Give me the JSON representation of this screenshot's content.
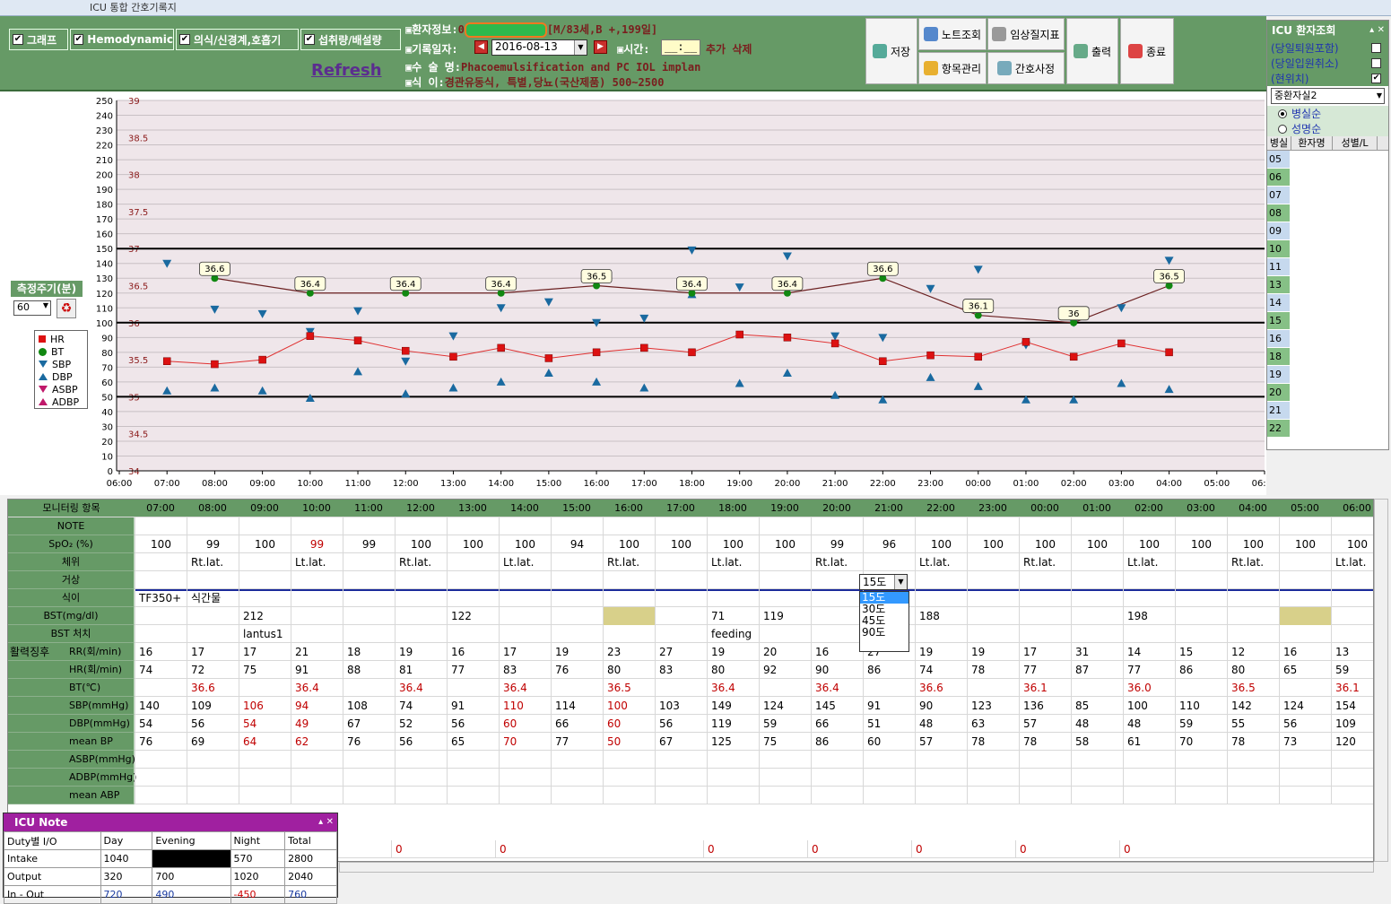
{
  "window": {
    "title": "ICU 통합 간호기록지"
  },
  "checkboxes": [
    {
      "label": "그래프",
      "checked": "✔"
    },
    {
      "label": "Hemodynamic",
      "checked": "✔"
    },
    {
      "label": "의식/신경계,호흡기",
      "checked": "✔"
    },
    {
      "label": "섭취량/배설량",
      "checked": "✔"
    }
  ],
  "refresh_label": "Refresh",
  "patient": {
    "info_label": "▣환자정보:",
    "info_prefix": "0",
    "info_value": "[M/83세,B +,199일]",
    "date_label": "▣기록일자:",
    "date_value": "2016-08-13",
    "time_label": "▣시간:",
    "time_value": "__:__",
    "add_label": "추가",
    "delete_label": "삭제",
    "surgery_label": "▣수 술 명:",
    "surgery_value": "Phacoemulsification and PC IOL implan",
    "diet_label": "▣식     이:",
    "diet_value": "경관유동식, 특별,당뇨(국산제품) 500~2500"
  },
  "toolbar": {
    "save": "저장",
    "note_view": "노트조회",
    "clinical": "임상질지표",
    "print": "출력",
    "exit": "종료",
    "item_mgmt": "항목관리",
    "nurse_dict": "간호사정"
  },
  "measure": {
    "label": "측정주기(분)",
    "value": "60"
  },
  "legend": [
    {
      "label": "HR",
      "color": "#dd1111",
      "shape": "square"
    },
    {
      "label": "BT",
      "color": "#118811",
      "shape": "circle"
    },
    {
      "label": "SBP",
      "color": "#1a6aa0",
      "shape": "tri-down"
    },
    {
      "label": "DBP",
      "color": "#1a6aa0",
      "shape": "tri-up"
    },
    {
      "label": "ASBP",
      "color": "#c0186a",
      "shape": "tri-down"
    },
    {
      "label": "ADBP",
      "color": "#c0186a",
      "shape": "tri-up"
    }
  ],
  "chart_data": {
    "type": "line",
    "y_left": {
      "min": 0,
      "max": 250,
      "step": 10
    },
    "y_right": {
      "min": 34,
      "max": 39,
      "ticks": [
        "39",
        "38.5",
        "38",
        "37.5",
        "37",
        "36.5",
        "36",
        "35.5",
        "35",
        "34.5",
        "34"
      ]
    },
    "x_labels": [
      "06:00",
      "07:00",
      "08:00",
      "09:00",
      "10:00",
      "11:00",
      "12:00",
      "13:00",
      "14:00",
      "15:00",
      "16:00",
      "17:00",
      "18:00",
      "19:00",
      "20:00",
      "21:00",
      "22:00",
      "23:00",
      "00:00",
      "01:00",
      "02:00",
      "03:00",
      "04:00",
      "05:00",
      "06:00"
    ],
    "ref_lines": [
      150,
      100,
      50
    ],
    "series": [
      {
        "name": "HR",
        "values": [
          74,
          72,
          75,
          91,
          88,
          81,
          77,
          83,
          76,
          80,
          83,
          80,
          92,
          90,
          86,
          74,
          78,
          77,
          87,
          77,
          86,
          80,
          null,
          null
        ]
      },
      {
        "name": "BT",
        "values": [
          null,
          36.6,
          null,
          36.4,
          null,
          36.4,
          null,
          36.4,
          null,
          36.5,
          null,
          36.4,
          null,
          36.4,
          null,
          36.6,
          null,
          36.1,
          null,
          36.0,
          null,
          36.5,
          null,
          null
        ]
      },
      {
        "name": "SBP",
        "values": [
          140,
          109,
          106,
          94,
          108,
          74,
          91,
          110,
          114,
          100,
          103,
          149,
          124,
          145,
          91,
          90,
          123,
          136,
          85,
          100,
          110,
          142,
          null,
          null
        ]
      },
      {
        "name": "DBP",
        "values": [
          54,
          56,
          54,
          49,
          67,
          52,
          56,
          60,
          66,
          60,
          56,
          119,
          59,
          66,
          51,
          48,
          63,
          57,
          48,
          48,
          59,
          55,
          null,
          null
        ]
      }
    ],
    "bt_labels": [
      "36.6",
      "36.4",
      "36.4",
      "36.4",
      "36.5",
      "36.4",
      "36.4",
      "36.6",
      "36.1",
      "36",
      "36.5"
    ]
  },
  "grid": {
    "header": "모니터링 항목",
    "times": [
      "07:00",
      "08:00",
      "09:00",
      "10:00",
      "11:00",
      "12:00",
      "13:00",
      "14:00",
      "15:00",
      "16:00",
      "17:00",
      "18:00",
      "19:00",
      "20:00",
      "21:00",
      "22:00",
      "23:00",
      "00:00",
      "01:00",
      "02:00",
      "03:00",
      "04:00",
      "05:00",
      "06:00"
    ],
    "rows": [
      {
        "label": "NOTE",
        "cells": [
          "",
          "",
          "",
          "",
          "",
          "",
          "",
          "",
          "",
          "",
          "",
          "",
          "",
          "",
          "",
          "",
          "",
          "",
          "",
          "",
          "",
          "",
          "",
          ""
        ]
      },
      {
        "label": "SpO₂ (%)",
        "cells": [
          "100",
          "99",
          "100",
          "99",
          "99",
          "100",
          "100",
          "100",
          "94",
          "100",
          "100",
          "100",
          "100",
          "99",
          "96",
          "100",
          "100",
          "100",
          "100",
          "100",
          "100",
          "100",
          "100",
          "100"
        ],
        "red": [
          3
        ],
        "center": true
      },
      {
        "label": "체위",
        "cells": [
          "",
          "Rt.lat.",
          "",
          "Lt.lat.",
          "",
          "Rt.lat.",
          "",
          "Lt.lat.",
          "",
          "Rt.lat.",
          "",
          "Lt.lat.",
          "",
          "Rt.lat.",
          "",
          "Lt.lat.",
          "",
          "Rt.lat.",
          "",
          "Lt.lat.",
          "",
          "Rt.lat.",
          "",
          "Lt.lat."
        ]
      },
      {
        "label": "거상",
        "cells": [
          "",
          "",
          "",
          "",
          "",
          "",
          "",
          "",
          "",
          "",
          "",
          "",
          "",
          "",
          "",
          "",
          "",
          "",
          "",
          "",
          "",
          "",
          "",
          ""
        ]
      },
      {
        "label": "식이",
        "cells": [
          "TF350+",
          "식간물",
          "",
          "",
          "",
          "",
          "",
          "",
          "",
          "",
          "",
          "",
          "",
          "",
          "",
          "",
          "",
          "",
          "",
          "",
          "",
          "",
          "",
          ""
        ]
      },
      {
        "label": "BST(mg/dl)",
        "cells": [
          "",
          "",
          "212",
          "",
          "",
          "",
          "122",
          "",
          "",
          "",
          "",
          "71",
          "119",
          "",
          "",
          "188",
          "",
          "",
          "",
          "198",
          "",
          "",
          "",
          ""
        ],
        "yellow": [
          9,
          22
        ]
      },
      {
        "label": "BST 처치",
        "cells": [
          "",
          "",
          "lantus1",
          "",
          "",
          "",
          "",
          "",
          "",
          "",
          "",
          "feeding",
          "",
          "",
          "",
          "",
          "",
          "",
          "",
          "",
          "",
          "",
          "",
          ""
        ]
      },
      {
        "label": "RR(회/min)",
        "cells": [
          "16",
          "17",
          "17",
          "21",
          "18",
          "19",
          "16",
          "17",
          "19",
          "23",
          "27",
          "19",
          "20",
          "16",
          "27",
          "19",
          "19",
          "17",
          "31",
          "14",
          "15",
          "12",
          "16",
          "13"
        ]
      },
      {
        "label": "HR(회/min)",
        "cells": [
          "74",
          "72",
          "75",
          "91",
          "88",
          "81",
          "77",
          "83",
          "76",
          "80",
          "83",
          "80",
          "92",
          "90",
          "86",
          "74",
          "78",
          "77",
          "87",
          "77",
          "86",
          "80",
          "65",
          "59"
        ]
      },
      {
        "label": "BT(℃)",
        "cells": [
          "",
          "36.6",
          "",
          "36.4",
          "",
          "36.4",
          "",
          "36.4",
          "",
          "36.5",
          "",
          "36.4",
          "",
          "36.4",
          "",
          "36.6",
          "",
          "36.1",
          "",
          "36.0",
          "",
          "36.5",
          "",
          "36.1"
        ],
        "allred": true
      },
      {
        "label": "SBP(mmHg)",
        "cells": [
          "140",
          "109",
          "106",
          "94",
          "108",
          "74",
          "91",
          "110",
          "114",
          "100",
          "103",
          "149",
          "124",
          "145",
          "91",
          "90",
          "123",
          "136",
          "85",
          "100",
          "110",
          "142",
          "124",
          "154"
        ],
        "red": [
          2,
          3,
          7,
          9
        ]
      },
      {
        "label": "DBP(mmHg)",
        "cells": [
          "54",
          "56",
          "54",
          "49",
          "67",
          "52",
          "56",
          "60",
          "66",
          "60",
          "56",
          "119",
          "59",
          "66",
          "51",
          "48",
          "63",
          "57",
          "48",
          "48",
          "59",
          "55",
          "56",
          "109"
        ],
        "red": [
          2,
          3,
          7,
          9
        ]
      },
      {
        "label": "mean BP",
        "cells": [
          "76",
          "69",
          "64",
          "62",
          "76",
          "56",
          "65",
          "70",
          "77",
          "50",
          "67",
          "125",
          "75",
          "86",
          "60",
          "57",
          "78",
          "78",
          "58",
          "61",
          "70",
          "78",
          "73",
          "120"
        ],
        "red": [
          2,
          3,
          7,
          9
        ]
      },
      {
        "label": "ASBP(mmHg)",
        "cells": [
          "",
          "",
          "",
          "",
          "",
          "",
          "",
          "",
          "",
          "",
          "",
          "",
          "",
          "",
          "",
          "",
          "",
          "",
          "",
          "",
          "",
          "",
          "",
          ""
        ]
      },
      {
        "label": "ADBP(mmHg)",
        "cells": [
          "",
          "",
          "",
          "",
          "",
          "",
          "",
          "",
          "",
          "",
          "",
          "",
          "",
          "",
          "",
          "",
          "",
          "",
          "",
          "",
          "",
          "",
          "",
          ""
        ]
      },
      {
        "label": "mean ABP",
        "cells": [
          "",
          "",
          "",
          "",
          "",
          "",
          "",
          "",
          "",
          "",
          "",
          "",
          "",
          "",
          "",
          "",
          "",
          "",
          "",
          "",
          "",
          "",
          "",
          ""
        ]
      }
    ],
    "group_label": "활력징후",
    "bottom_zeros": [
      "0",
      "0",
      "0",
      "0",
      "0",
      "0",
      "0",
      "0"
    ]
  },
  "dropdown": {
    "value": "15도",
    "options": [
      "15도",
      "30도",
      "45도",
      "90도"
    ]
  },
  "sidepanel": {
    "title": "ICU 환자조회",
    "opt1": "(당일퇴원포함)",
    "opt2": "(당일입원취소)",
    "opt3": "(현위치)",
    "opt3_checked": "✔",
    "combo": "중환자실2",
    "radio1": "병실순",
    "radio2": "성명순",
    "cols": [
      "병실",
      "환자명",
      "성별/L"
    ],
    "rooms": [
      "05",
      "06",
      "07",
      "08",
      "09",
      "10",
      "11",
      "13",
      "14",
      "15",
      "16",
      "18",
      "19",
      "20",
      "21",
      "22"
    ]
  },
  "note": {
    "title": "ICU Note",
    "headers": [
      "Duty별 I/O",
      "Day",
      "Evening",
      "Night",
      "Total"
    ],
    "rows": [
      [
        "Intake",
        "1040",
        "",
        "570",
        "2800"
      ],
      [
        "Output",
        "320",
        "700",
        "1020",
        "2040"
      ],
      [
        "In - Out",
        "720",
        "490",
        "-450",
        "760"
      ]
    ]
  }
}
